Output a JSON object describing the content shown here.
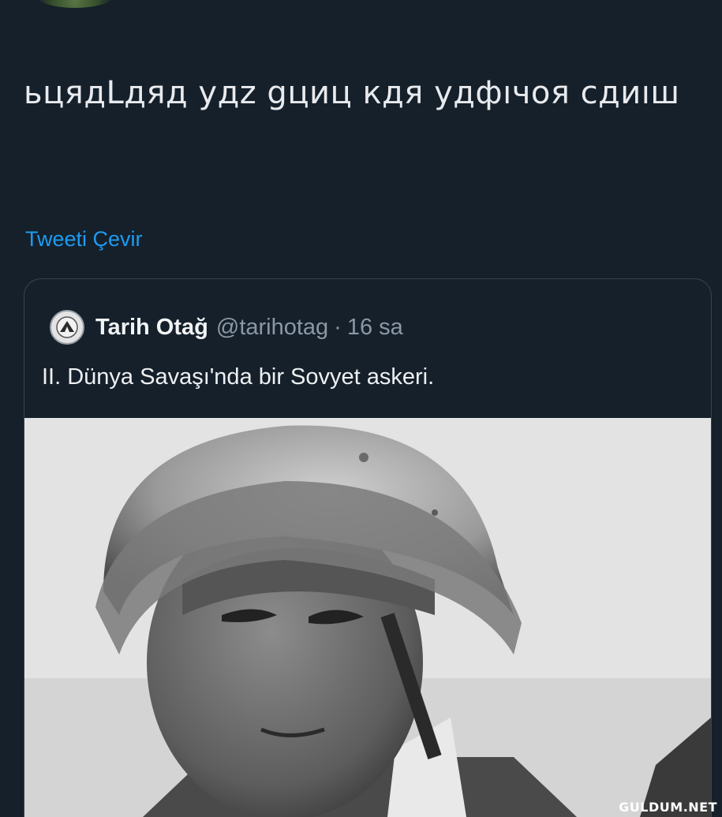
{
  "tweet": {
    "text": "ьцядLдяд удz gциц кдя удфıчоя сдиıш",
    "translate_label": "Tweeti Çevir"
  },
  "quoted_tweet": {
    "author_name": "Tarih Otağ",
    "author_handle": "@tarihotag",
    "separator": "·",
    "time": "16 sa",
    "text": "II. Dünya Savaşı'nda bir Sovyet askeri."
  },
  "watermark": "GULDUM.NET"
}
